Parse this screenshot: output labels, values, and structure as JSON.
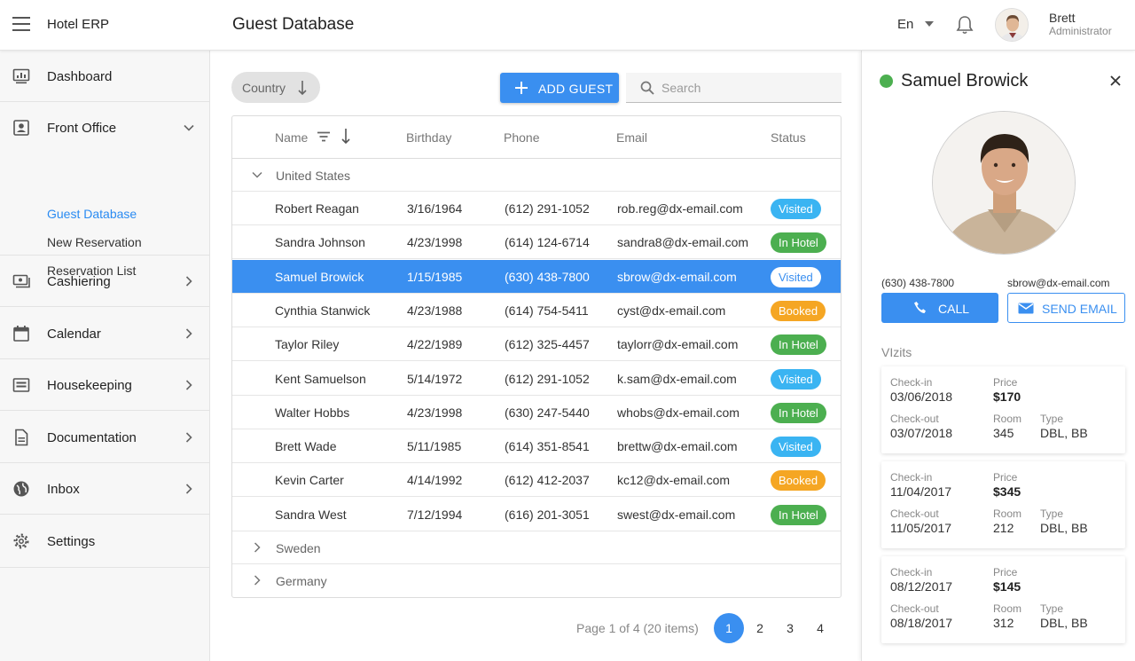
{
  "header": {
    "app_title": "Hotel ERP",
    "page_title": "Guest Database",
    "language": "En",
    "user_name": "Brett",
    "user_role": "Administrator"
  },
  "sidebar": {
    "items": [
      {
        "label": "Dashboard",
        "icon": "dashboard-icon"
      },
      {
        "label": "Front Office",
        "icon": "front-office-icon",
        "expanded": true
      },
      {
        "label": "Cashiering",
        "icon": "cashiering-icon"
      },
      {
        "label": "Calendar",
        "icon": "calendar-icon"
      },
      {
        "label": "Housekeeping",
        "icon": "housekeeping-icon"
      },
      {
        "label": "Documentation",
        "icon": "documentation-icon"
      },
      {
        "label": "Inbox",
        "icon": "inbox-icon"
      },
      {
        "label": "Settings",
        "icon": "settings-icon"
      }
    ],
    "front_office_sub": [
      "Guest Database",
      "New Reservation",
      "Reservation List"
    ]
  },
  "toolbar": {
    "group_chip": "Country",
    "add_label": "ADD GUEST",
    "search_placeholder": "Search"
  },
  "grid": {
    "columns": [
      "Name",
      "Birthday",
      "Phone",
      "Email",
      "Status"
    ],
    "groups": [
      "United States",
      "Sweden",
      "Germany"
    ],
    "rows": [
      {
        "name": "Robert Reagan",
        "birthday": "3/16/1964",
        "phone": "(612) 291-1052",
        "email": "rob.reg@dx-email.com",
        "status": "Visited"
      },
      {
        "name": "Sandra Johnson",
        "birthday": "4/23/1998",
        "phone": "(614) 124-6714",
        "email": "sandra8@dx-email.com",
        "status": "In Hotel"
      },
      {
        "name": "Samuel Browick",
        "birthday": "1/15/1985",
        "phone": "(630) 438-7800",
        "email": "sbrow@dx-email.com",
        "status": "Visited"
      },
      {
        "name": "Cynthia Stanwick",
        "birthday": "4/23/1988",
        "phone": "(614) 754-5411",
        "email": "cyst@dx-email.com",
        "status": "Booked"
      },
      {
        "name": "Taylor Riley",
        "birthday": "4/22/1989",
        "phone": "(612) 325-4457",
        "email": "taylorr@dx-email.com",
        "status": "In Hotel"
      },
      {
        "name": "Kent Samuelson",
        "birthday": "5/14/1972",
        "phone": "(612) 291-1052",
        "email": "k.sam@dx-email.com",
        "status": "Visited"
      },
      {
        "name": "Walter Hobbs",
        "birthday": "4/23/1998",
        "phone": "(630) 247-5440",
        "email": "whobs@dx-email.com",
        "status": "In Hotel"
      },
      {
        "name": "Brett Wade",
        "birthday": "5/11/1985",
        "phone": "(614) 351-8541",
        "email": "brettw@dx-email.com",
        "status": "Visited"
      },
      {
        "name": "Kevin Carter",
        "birthday": "4/14/1992",
        "phone": "(612) 412-2037",
        "email": "kc12@dx-email.com",
        "status": "Booked"
      },
      {
        "name": "Sandra West",
        "birthday": "7/12/1994",
        "phone": "(616) 201-3051",
        "email": "swest@dx-email.com",
        "status": "In Hotel"
      }
    ],
    "selected_row": 2
  },
  "status_colors": {
    "Visited": "#3ab4f2",
    "In Hotel": "#4caf50",
    "Booked": "#f5a623"
  },
  "pager": {
    "info": "Page 1 of 4 (20 items)",
    "pages": [
      "1",
      "2",
      "3",
      "4"
    ],
    "current": "1"
  },
  "panel": {
    "name": "Samuel Browick",
    "status_color": "#4caf50",
    "phone": "(630) 438-7800",
    "email": "sbrow@dx-email.com",
    "call_label": "CALL",
    "email_label": "SEND EMAIL",
    "visits_title": "VIzits",
    "labels": {
      "check_in": "Check-in",
      "check_out": "Check-out",
      "price": "Price",
      "room": "Room",
      "type": "Type"
    },
    "visits": [
      {
        "check_in": "03/06/2018",
        "check_out": "03/07/2018",
        "price": "$170",
        "room": "345",
        "type": "DBL, BB"
      },
      {
        "check_in": "11/04/2017",
        "check_out": "11/05/2017",
        "price": "$345",
        "room": "212",
        "type": "DBL, BB"
      },
      {
        "check_in": "08/12/2017",
        "check_out": "08/18/2017",
        "price": "$145",
        "room": "312",
        "type": "DBL, BB"
      }
    ]
  },
  "accent_color": "#3a8ff0"
}
